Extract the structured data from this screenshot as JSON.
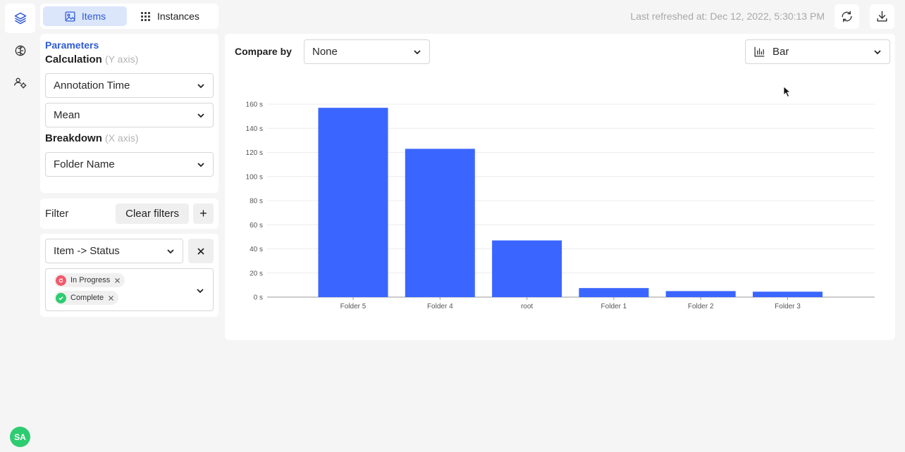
{
  "nav": {
    "tabs": [
      {
        "label": "Items",
        "active": true
      },
      {
        "label": "Instances",
        "active": false
      }
    ]
  },
  "header": {
    "refreshed": "Last refreshed at: Dec 12, 2022, 5:30:13 PM"
  },
  "user": {
    "initials": "SA"
  },
  "parameters": {
    "title": "Parameters",
    "calculation_label": "Calculation",
    "calculation_hint": "(Y axis)",
    "metric": "Annotation Time",
    "aggregation": "Mean",
    "breakdown_label": "Breakdown",
    "breakdown_hint": "(X axis)",
    "breakdown": "Folder Name"
  },
  "filter": {
    "label": "Filter",
    "clear_label": "Clear filters",
    "add_label": "+",
    "rule_field": "Item -> Status",
    "chips": [
      "In Progress",
      "Complete"
    ]
  },
  "chart_controls": {
    "compare_label": "Compare by",
    "compare_value": "None",
    "chart_type": "Bar"
  },
  "colors": {
    "accent": "#2f5bd6",
    "bar": "#3a66ff",
    "chip_in_progress": "#f05a6b",
    "chip_complete": "#2ecc71"
  },
  "chart_data": {
    "type": "bar",
    "categories": [
      "Folder 5",
      "Folder 4",
      "root",
      "Folder 1",
      "Folder 2",
      "Folder 3"
    ],
    "values": [
      157,
      123,
      47,
      7.5,
      5,
      4.5
    ],
    "ylim": [
      0,
      160
    ],
    "yticks": [
      0,
      20,
      40,
      60,
      80,
      100,
      120,
      140,
      160
    ],
    "yunit": "s",
    "grid": true,
    "legend": "none"
  }
}
